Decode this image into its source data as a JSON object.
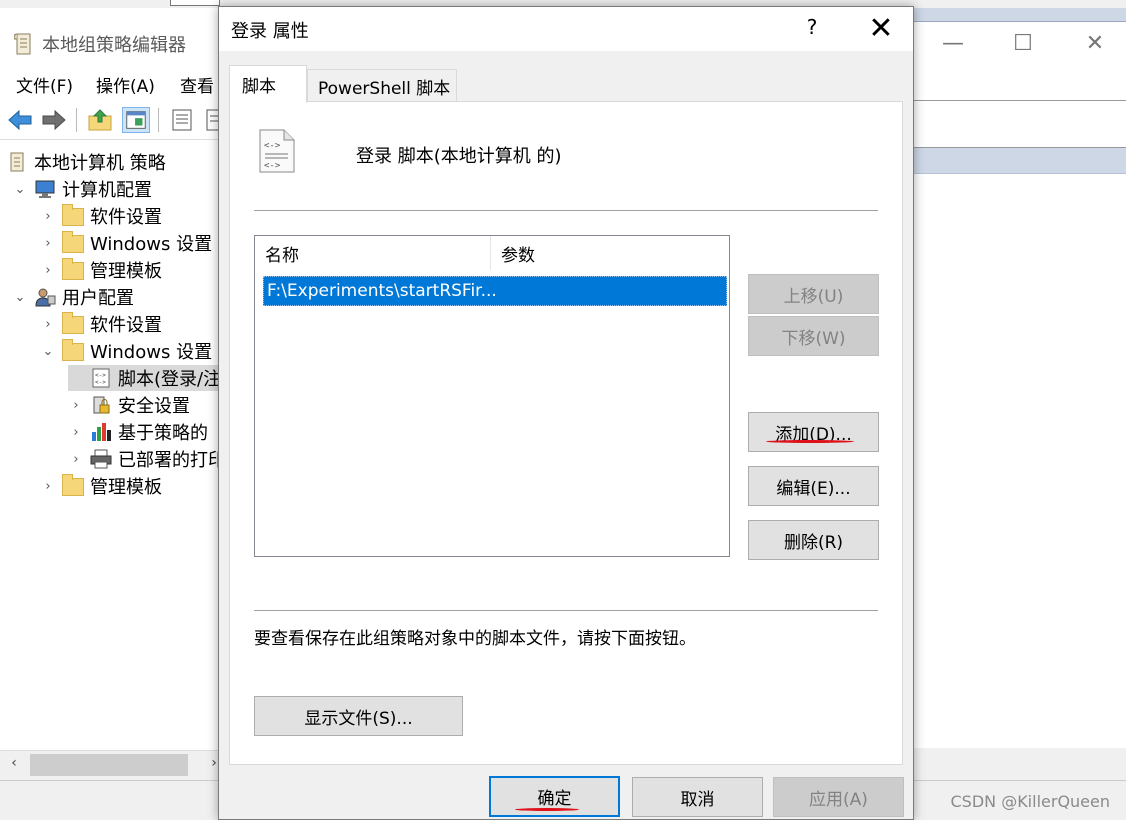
{
  "background_window": {
    "title": "本地组策略编辑器",
    "menu": [
      "文件(F)",
      "操作(A)",
      "查看"
    ],
    "tree": [
      {
        "label": "本地计算机 策略",
        "expand": "",
        "icon": "policy-icon"
      },
      {
        "label": "计算机配置",
        "expand": "⌄",
        "icon": "computer-icon"
      },
      {
        "label": "软件设置",
        "expand": "›",
        "icon": "folder-icon"
      },
      {
        "label": "Windows 设置",
        "expand": "›",
        "icon": "folder-icon"
      },
      {
        "label": "管理模板",
        "expand": "›",
        "icon": "folder-icon"
      },
      {
        "label": "用户配置",
        "expand": "⌄",
        "icon": "user-icon"
      },
      {
        "label": "软件设置",
        "expand": "›",
        "icon": "folder-icon"
      },
      {
        "label": "Windows 设置",
        "expand": "⌄",
        "icon": "folder-icon"
      },
      {
        "label": "脚本(登录/注",
        "expand": "",
        "icon": "script-icon"
      },
      {
        "label": "安全设置",
        "expand": "›",
        "icon": "security-icon"
      },
      {
        "label": "基于策略的",
        "expand": "›",
        "icon": "chart-icon"
      },
      {
        "label": "已部署的打印",
        "expand": "›",
        "icon": "printer-icon"
      },
      {
        "label": "管理模板",
        "expand": "›",
        "icon": "folder-icon"
      }
    ],
    "watermark": "CSDN @KillerQueen"
  },
  "dialog": {
    "title": "登录 属性",
    "help_label": "?",
    "close_label": "✕",
    "tabs": [
      "脚本",
      "PowerShell 脚本"
    ],
    "heading": "登录 脚本(本地计算机 的)",
    "list": {
      "columns": [
        "名称",
        "参数"
      ],
      "rows": [
        {
          "name": "F:\\Experiments\\startRSFir...",
          "params": ""
        }
      ]
    },
    "side_buttons": {
      "up": "上移(U)",
      "down": "下移(W)",
      "add": "添加(D)...",
      "edit": "编辑(E)...",
      "remove": "删除(R)"
    },
    "note": "要查看保存在此组策略对象中的脚本文件，请按下面按钮。",
    "show_files": "显示文件(S)...",
    "footer": {
      "ok": "确定",
      "cancel": "取消",
      "apply": "应用(A)"
    }
  },
  "colors": {
    "selection": "#0078d7",
    "annotation_red": "#e0101a",
    "disabled_text": "#838383"
  }
}
